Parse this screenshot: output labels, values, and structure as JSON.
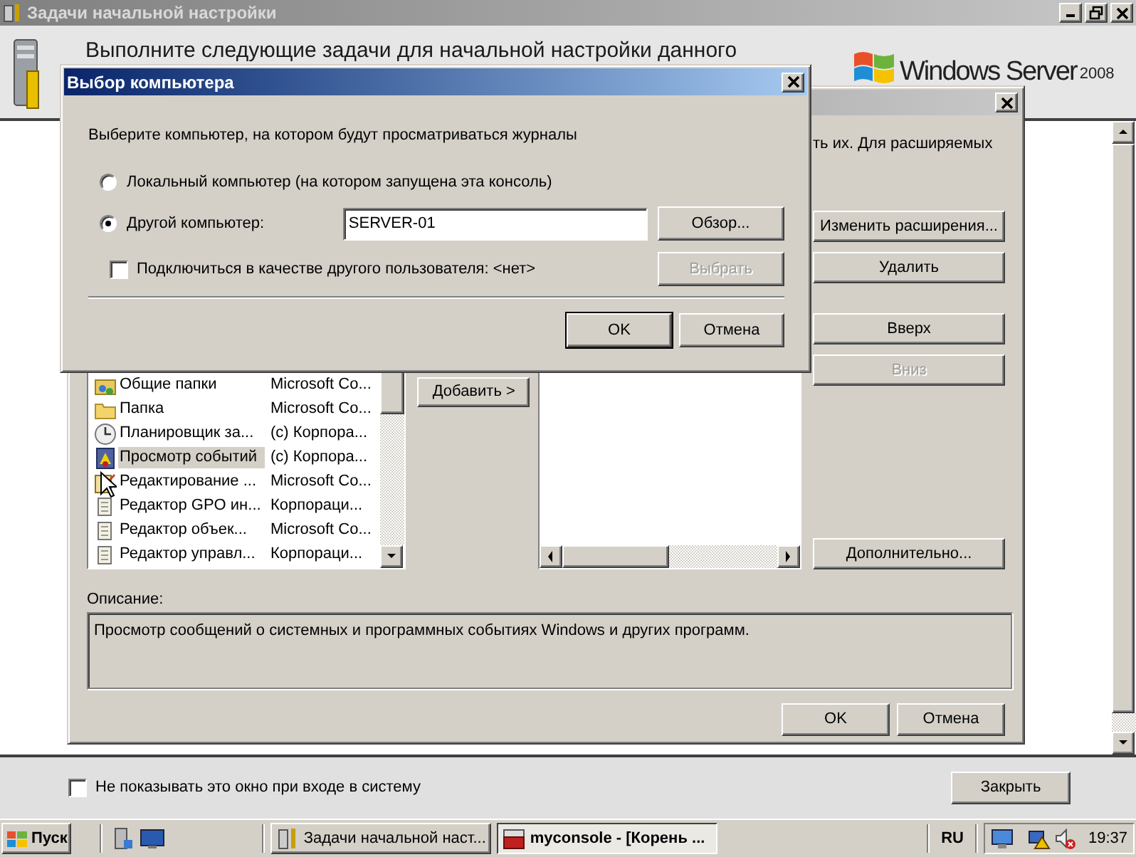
{
  "main_window": {
    "title": "Задачи начальной настройки",
    "active": false,
    "header_text": "Выполните следующие задачи для начальной настройки данного",
    "logo": {
      "brand": "Windows Server",
      "version": "2008"
    },
    "footer": {
      "checkbox": {
        "label": "Не показывать это окно при входе в систему",
        "checked": false
      },
      "close_button": "Закрыть"
    }
  },
  "snapin_dialog": {
    "active": false,
    "intro_text": "ть их. Для расширяемых",
    "available_snapins": [
      {
        "name": "Общие папки",
        "vendor": "Microsoft Co...",
        "selected": false
      },
      {
        "name": "Папка",
        "vendor": "Microsoft Co...",
        "selected": false
      },
      {
        "name": "Планировщик за...",
        "vendor": "(c) Корпора...",
        "selected": false
      },
      {
        "name": "Просмотр событий",
        "vendor": "(c) Корпора...",
        "selected": true
      },
      {
        "name": "Редактирование ...",
        "vendor": "Microsoft Co...",
        "selected": false
      },
      {
        "name": "Редактор GPO ин...",
        "vendor": "Корпораци...",
        "selected": false
      },
      {
        "name": "Редактор объек...",
        "vendor": "Microsoft Co...",
        "selected": false
      },
      {
        "name": "Редактор управл...",
        "vendor": "Корпораци...",
        "selected": false
      }
    ],
    "add_button": "Добавить >",
    "side_buttons": [
      {
        "label": "Изменить расширения...",
        "disabled": false
      },
      {
        "label": "Удалить",
        "disabled": false
      },
      {
        "label": "Вверх",
        "disabled": false
      },
      {
        "label": "Вниз",
        "disabled": true
      },
      {
        "label": "Дополнительно...",
        "disabled": false
      }
    ],
    "description_label": "Описание:",
    "description": "Просмотр сообщений о системных и программных событиях Windows и других программ.",
    "buttons": [
      "OK",
      "Отмена"
    ]
  },
  "computer_dialog": {
    "title": "Выбор компьютера",
    "active": true,
    "prompt": "Выберите компьютер, на котором будут просматриваться журналы",
    "options": [
      {
        "label": "Локальный компьютер (на котором запущена эта консоль)",
        "selected": false
      },
      {
        "label": "Другой компьютер:",
        "selected": true
      }
    ],
    "computer_name": "SERVER-01",
    "browse_button": "Обзор...",
    "connect_as": {
      "label": "Подключиться в качестве другого пользователя: <нет>",
      "checked": false
    },
    "select_button": {
      "label": "Выбрать",
      "disabled": true
    },
    "buttons": [
      {
        "label": "OK",
        "default": true
      },
      {
        "label": "Отмена",
        "default": false
      }
    ]
  },
  "taskbar": {
    "start": "Пуск",
    "tasks": [
      {
        "label": "Задачи начальной наст...",
        "active": false
      },
      {
        "label": "myconsole - [Корень ...",
        "active": true
      }
    ],
    "language": "RU",
    "clock": "19:37"
  }
}
